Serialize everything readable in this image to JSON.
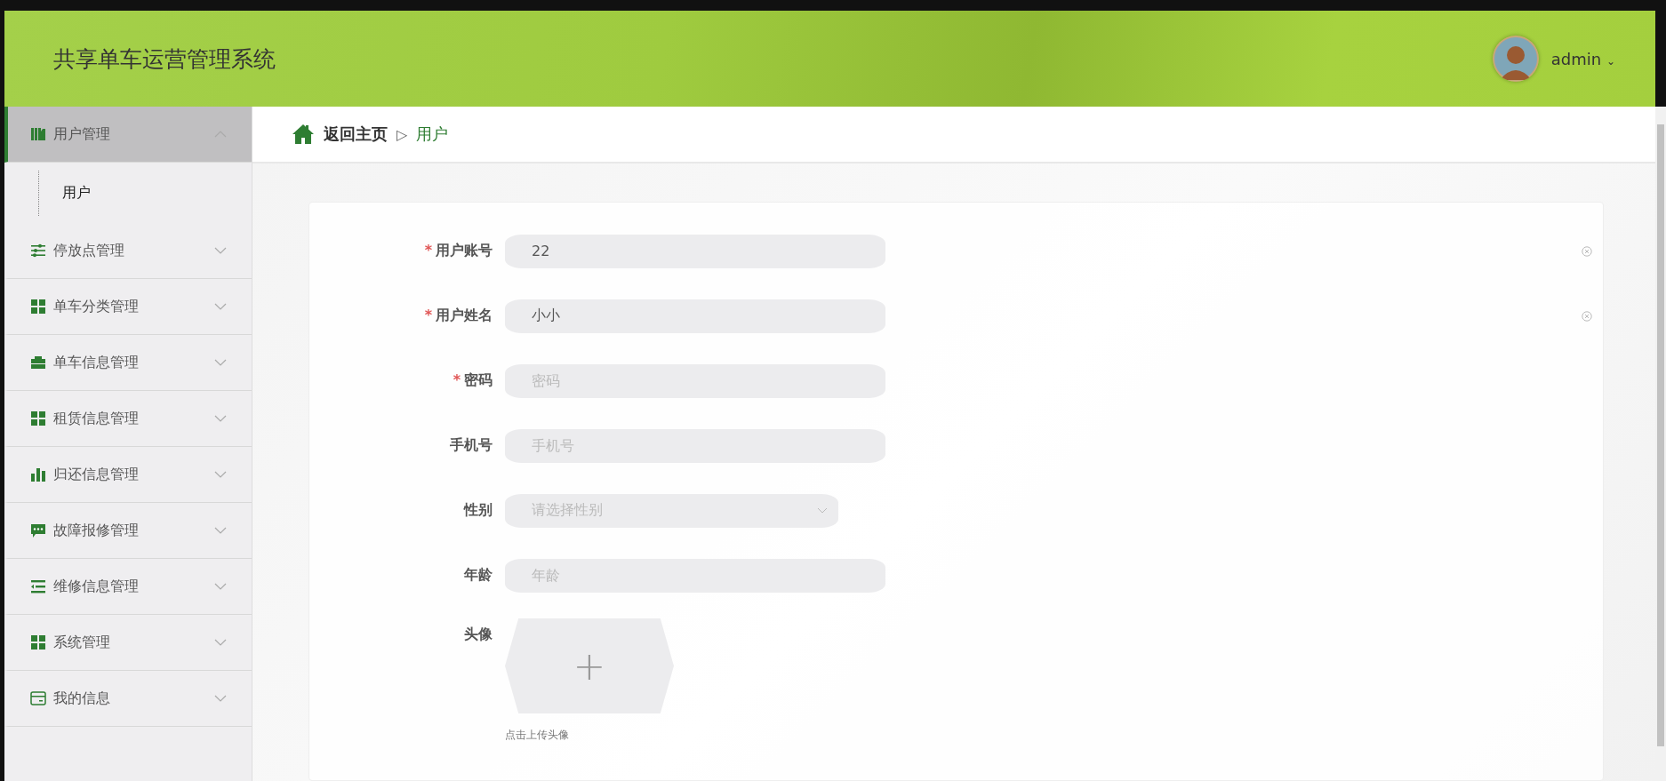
{
  "header": {
    "title": "共享单车运营管理系统",
    "user": "admin",
    "menu_caret": "⌄"
  },
  "sidebar": {
    "items": [
      {
        "label": "用户管理",
        "selected": true,
        "expanded": true,
        "children": [
          {
            "label": "用户"
          }
        ]
      },
      {
        "label": "停放点管理",
        "selected": false,
        "expanded": false
      },
      {
        "label": "单车分类管理",
        "selected": false,
        "expanded": false
      },
      {
        "label": "单车信息管理",
        "selected": false,
        "expanded": false
      },
      {
        "label": "租赁信息管理",
        "selected": false,
        "expanded": false
      },
      {
        "label": "归还信息管理",
        "selected": false,
        "expanded": false
      },
      {
        "label": "故障报修管理",
        "selected": false,
        "expanded": false
      },
      {
        "label": "维修信息管理",
        "selected": false,
        "expanded": false
      },
      {
        "label": "系统管理",
        "selected": false,
        "expanded": false
      },
      {
        "label": "我的信息",
        "selected": false,
        "expanded": false
      }
    ]
  },
  "breadcrumb": {
    "home": "返回主页",
    "separator": "▷",
    "current": "用户"
  },
  "form": {
    "required_mark": "*",
    "fields": [
      {
        "kind": "input",
        "label": "用户账号",
        "required": true,
        "value": "22",
        "clearable": true
      },
      {
        "kind": "input",
        "label": "用户姓名",
        "required": true,
        "value": "小小",
        "clearable": true
      },
      {
        "kind": "input",
        "label": "密码",
        "required": true,
        "placeholder": "密码",
        "clearable": false
      },
      {
        "kind": "input",
        "label": "手机号",
        "required": false,
        "placeholder": "手机号",
        "clearable": false
      },
      {
        "kind": "select",
        "label": "性别",
        "required": false,
        "placeholder": "请选择性别"
      },
      {
        "kind": "input",
        "label": "年龄",
        "required": false,
        "placeholder": "年龄",
        "clearable": false
      },
      {
        "kind": "upload",
        "label": "头像",
        "required": false,
        "hint": "点击上传头像",
        "plus": "+"
      }
    ]
  }
}
